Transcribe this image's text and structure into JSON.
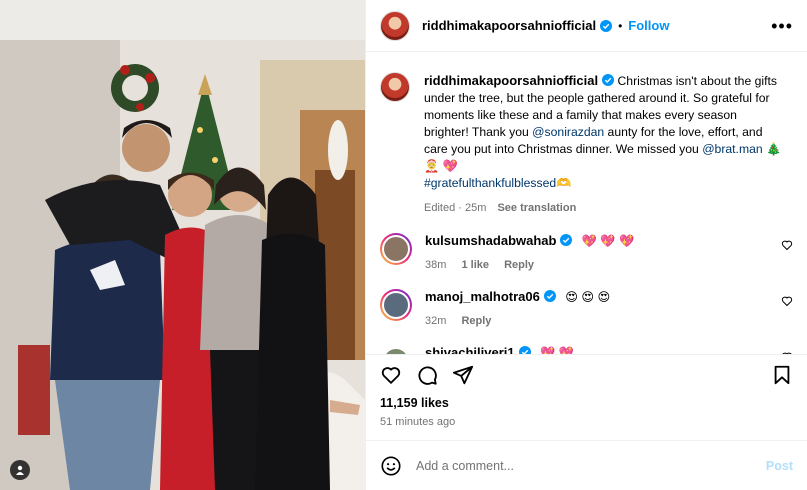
{
  "post": {
    "username": "riddhimakapoorsahniofficial",
    "follow_label": "Follow",
    "separator": "•",
    "more_label": "•••"
  },
  "caption": {
    "username": "riddhimakapoorsahniofficial",
    "text_1": "Christmas isn't about the gifts under the tree, but the people gathered around it. So grateful for moments like these and a family that makes every season brighter! Thank you ",
    "mention_1": "@sonirazdan",
    "text_2": " aunty for the love, effort, and care you put into Christmas dinner. We missed you ",
    "mention_2": "@brat.man",
    "emojis": " 🎄 🤶 💖",
    "hashtag": "#gratefulthankfulblessed",
    "hashtag_emoji": "🫶",
    "edited": "Edited · 25m",
    "see_translation": "See translation"
  },
  "comments": [
    {
      "username": "kulsumshadabwahab",
      "text": "💖 💖 💖",
      "time": "38m",
      "likes": "1 like",
      "reply": "Reply",
      "avatar_color": "#8a7565",
      "ring": true
    },
    {
      "username": "manoj_malhotra06",
      "text": "😍 😍 😍",
      "time": "32m",
      "likes": "",
      "reply": "Reply",
      "avatar_color": "#5a6b7e",
      "ring": true
    },
    {
      "username": "shivachiliveri1",
      "text": "💖 💖",
      "time": "",
      "likes": "",
      "reply": "",
      "avatar_color": "#7a8a6e",
      "ring": false
    }
  ],
  "stats": {
    "likes": "11,159 likes",
    "time_ago": "51 minutes ago"
  },
  "composer": {
    "placeholder": "Add a comment...",
    "post_label": "Post"
  },
  "colors": {
    "accent": "#0095f6",
    "link": "#00376b",
    "muted": "#737373",
    "heart": "#ed4956"
  },
  "icons": [
    "heart-icon",
    "comment-icon",
    "share-icon",
    "bookmark-icon",
    "emoji-icon",
    "verified-icon",
    "tag-user-icon"
  ]
}
